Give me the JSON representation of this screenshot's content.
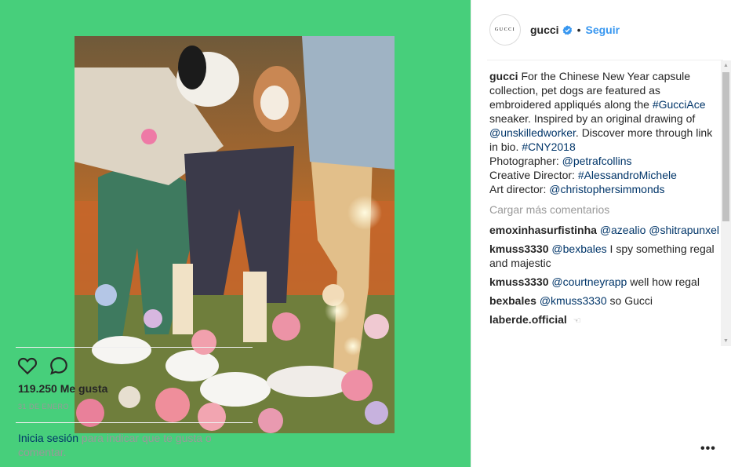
{
  "post": {
    "account": {
      "username": "gucci",
      "avatar_text": "GUCCI",
      "follow_label": "Seguir",
      "dot": "•"
    },
    "caption": {
      "username": "gucci",
      "text_1": "For the Chinese New Year capsule collection, pet dogs are featured as embroidered appliqués along the ",
      "tag_1": "#GucciAce",
      "text_2": " sneaker. Inspired by an original drawing of ",
      "mention_1": "@unskilledworker",
      "text_3": ". Discover more through link in bio. ",
      "tag_2": "#CNY2018",
      "line_photographer": "Photographer: ",
      "mention_2": "@petrafcollins",
      "line_creative": "Creative Director: ",
      "tag_3": "#AlessandroMichele",
      "line_art": "Art director: ",
      "mention_3": "@christophersimmonds"
    },
    "load_more": "Cargar más comentarios",
    "comments": [
      {
        "user": "emoxinhasurfistinha",
        "mention": "@azealio",
        "text": "",
        "mention_2": "@shitrapunxel"
      },
      {
        "user": "kmuss3330",
        "mention": "@bexbales",
        "text": " I spy something regal and majestic"
      },
      {
        "user": "kmuss3330",
        "mention": "@courtneyrapp",
        "text": " well how regal"
      },
      {
        "user": "bexbales",
        "mention": "@kmuss3330",
        "text": " so Gucci"
      },
      {
        "user": "laberde.official",
        "text": ""
      }
    ],
    "likes": "119.250 Me gusta",
    "date": "31 DE ENERO",
    "login_link": "Inicia sesión",
    "login_text": " para indicar que te gusta o comentar.",
    "more_label": "•••"
  },
  "colors": {
    "background": "#47cf7b",
    "link": "#003569",
    "follow": "#3897f0",
    "verified": "#3897f0"
  }
}
